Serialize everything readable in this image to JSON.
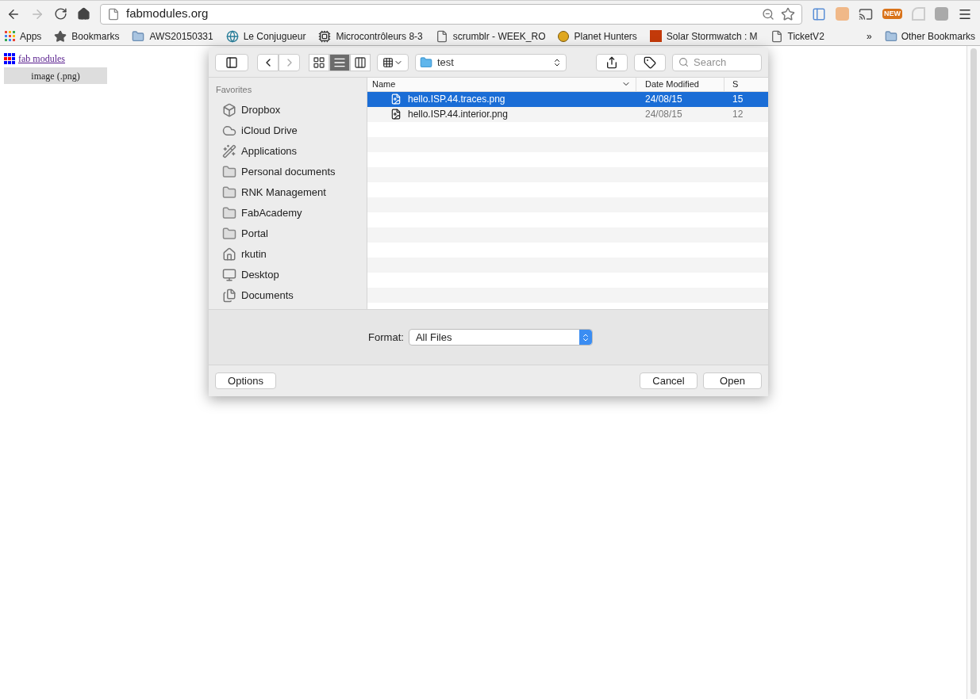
{
  "browser": {
    "address": "fabmodules.org",
    "extension_badge": "NEW",
    "bookmarks": [
      {
        "label": "Apps",
        "kind": "apps"
      },
      {
        "label": "Bookmarks",
        "kind": "star"
      },
      {
        "label": "AWS20150331",
        "kind": "folder"
      },
      {
        "label": "Le Conjugueur",
        "kind": "logo"
      },
      {
        "label": "Microcontrôleurs 8-3",
        "kind": "chip"
      },
      {
        "label": "scrumblr - WEEK_RO",
        "kind": "page"
      },
      {
        "label": "Planet Hunters",
        "kind": "planet"
      },
      {
        "label": "Solar Stormwatch : M",
        "kind": "sun"
      },
      {
        "label": "TicketV2",
        "kind": "page"
      }
    ],
    "overflow": "»",
    "other_bookmarks": "Other Bookmarks"
  },
  "page": {
    "link": "fab modules",
    "input_button": "image (.png)"
  },
  "dialog": {
    "view_modes": [
      {
        "kind": "icons",
        "selected": false
      },
      {
        "kind": "list",
        "selected": true
      },
      {
        "kind": "columns",
        "selected": false
      }
    ],
    "location": "test",
    "search": {
      "placeholder": "Search"
    },
    "sidebar": {
      "heading": "Favorites",
      "items": [
        {
          "label": "Dropbox",
          "kind": "dropbox"
        },
        {
          "label": "iCloud Drive",
          "kind": "cloud"
        },
        {
          "label": "Applications",
          "kind": "apps"
        },
        {
          "label": "Personal documents",
          "kind": "folder"
        },
        {
          "label": "RNK Management",
          "kind": "folder"
        },
        {
          "label": "FabAcademy",
          "kind": "folder"
        },
        {
          "label": "Portal",
          "kind": "folder"
        },
        {
          "label": "rkutin",
          "kind": "home"
        },
        {
          "label": "Desktop",
          "kind": "desktop"
        },
        {
          "label": "Documents",
          "kind": "documents"
        }
      ]
    },
    "columns": [
      "Name",
      "Date Modified",
      "S"
    ],
    "files": [
      {
        "name": "hello.ISP.44.traces.png",
        "date": "24/08/15",
        "size": "15",
        "selected": true
      },
      {
        "name": "hello.ISP.44.interior.png",
        "date": "24/08/15",
        "size": "12",
        "selected": false
      }
    ],
    "format": {
      "label": "Format:",
      "value": "All Files"
    },
    "buttons": {
      "options": "Options",
      "cancel": "Cancel",
      "open": "Open"
    }
  }
}
